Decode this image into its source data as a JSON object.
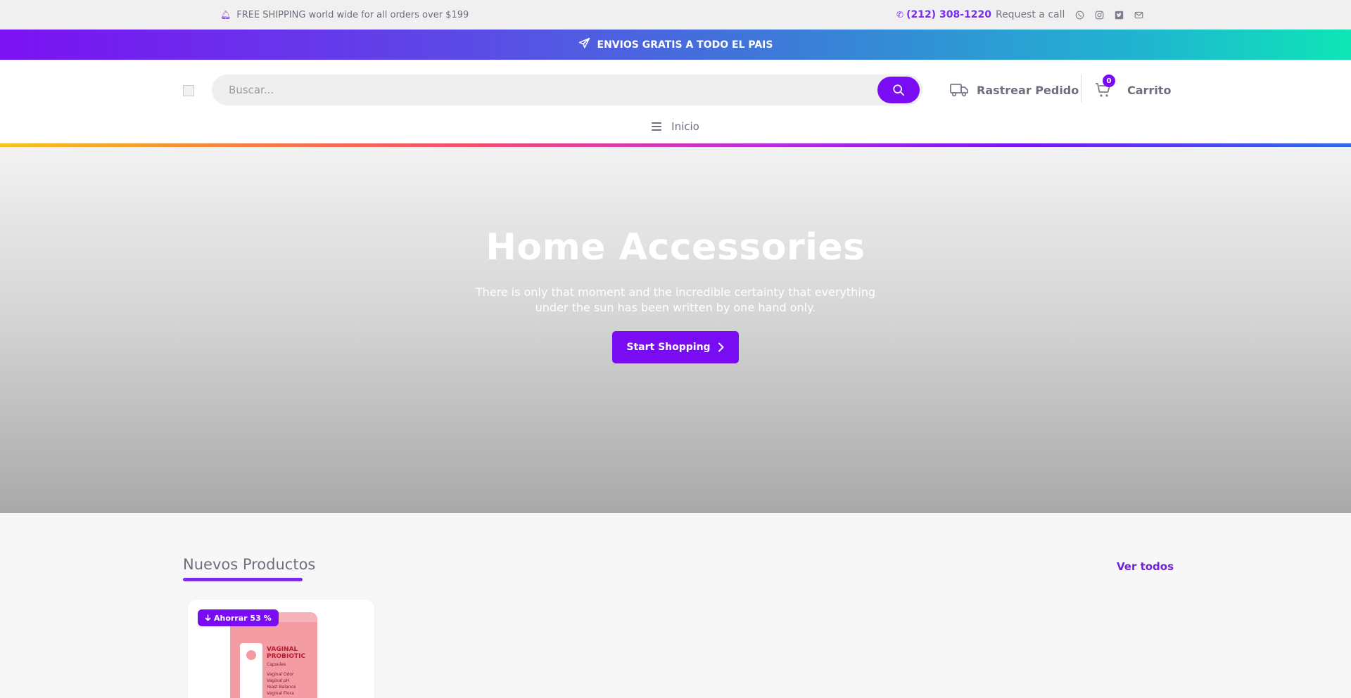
{
  "topbar": {
    "shipping_text": "FREE SHIPPING world wide for all orders over $199",
    "phone": "(212) 308-1220",
    "request": "Request a call",
    "social_icons": [
      "whatsapp-icon",
      "instagram-icon",
      "twitter-icon",
      "mail-icon"
    ]
  },
  "promo": {
    "text": "ENVIOS GRATIS A TODO EL PAIS"
  },
  "header": {
    "search_placeholder": "Buscar...",
    "track_label": "Rastrear Pedido",
    "cart_label": "Carrito",
    "cart_count": "0"
  },
  "nav": {
    "item": "Inicio"
  },
  "hero": {
    "title": "Home Accessories",
    "subtitle": "There is only that moment and the incredible certainty that everything under the sun has been written by one hand only.",
    "button": "Start Shopping"
  },
  "products": {
    "title": "Nuevos Productos",
    "see_all": "Ver todos",
    "items": [
      {
        "badge": "Ahorrar 53 %",
        "label": "VAGINAL PROBIOTIC",
        "sub": "Capsules",
        "lines": [
          "Vaginal Odor",
          "Vaginal pH",
          "Yeast Balance",
          "Vaginal Flora"
        ]
      }
    ]
  },
  "colors": {
    "accent": "#7a0cf3",
    "promo_gradient_start": "#7b12f2",
    "promo_gradient_end": "#0ee6b6"
  }
}
